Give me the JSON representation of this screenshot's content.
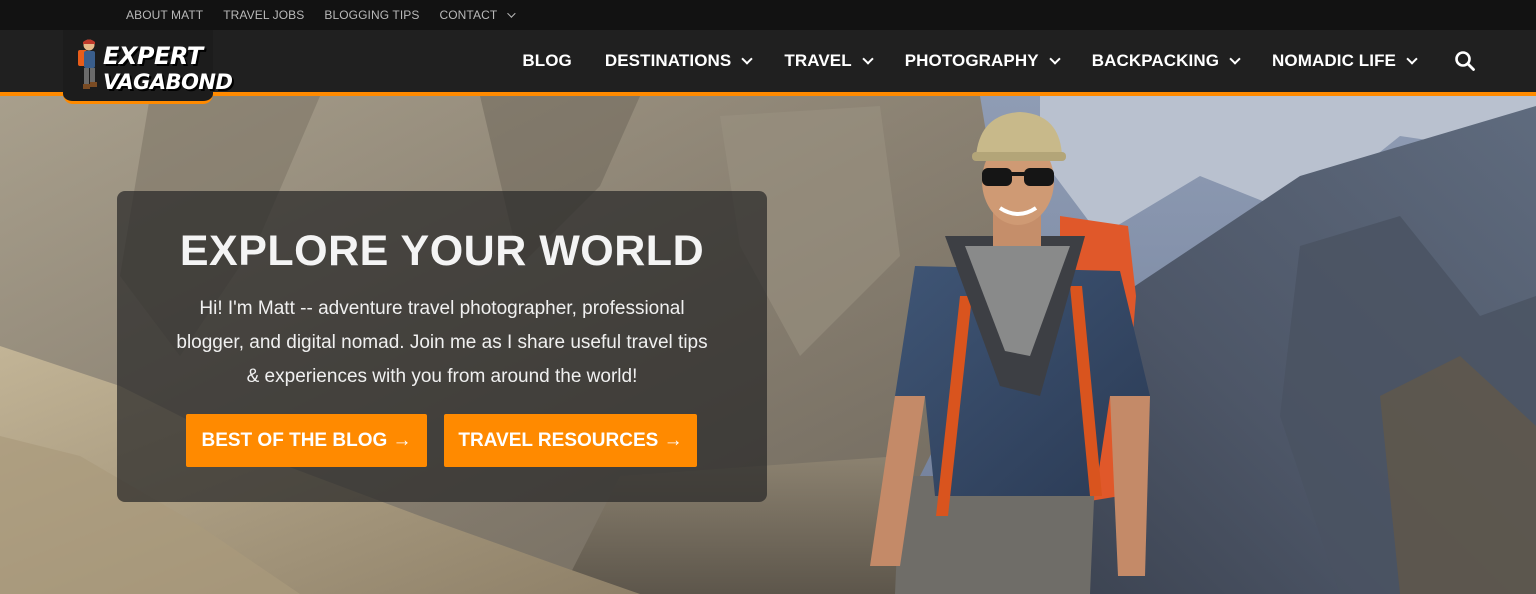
{
  "topbar": {
    "links": [
      "ABOUT MATT",
      "TRAVEL JOBS",
      "BLOGGING TIPS",
      "CONTACT"
    ]
  },
  "logo": {
    "line1": "EXPERT",
    "line2": "VAGABOND"
  },
  "nav": {
    "blog": "BLOG",
    "destinations": "DESTINATIONS",
    "travel": "TRAVEL",
    "photography": "PHOTOGRAPHY",
    "backpacking": "BACKPACKING",
    "nomadic_life": "NOMADIC LIFE"
  },
  "hero": {
    "title": "EXPLORE YOUR WORLD",
    "text": "Hi! I'm Matt -- adventure travel photographer, professional blogger, and digital nomad. Join me as I share useful travel tips & experiences with you from around the world!",
    "btn_blog": "BEST OF THE BLOG →",
    "btn_resources": "TRAVEL RESOURCES →"
  },
  "icons": {
    "search": "search-icon",
    "dropdown": "chevron-down-icon"
  },
  "colors": {
    "accent": "#ff8a00",
    "header_bg": "#202020",
    "topbar_bg": "#121212"
  }
}
